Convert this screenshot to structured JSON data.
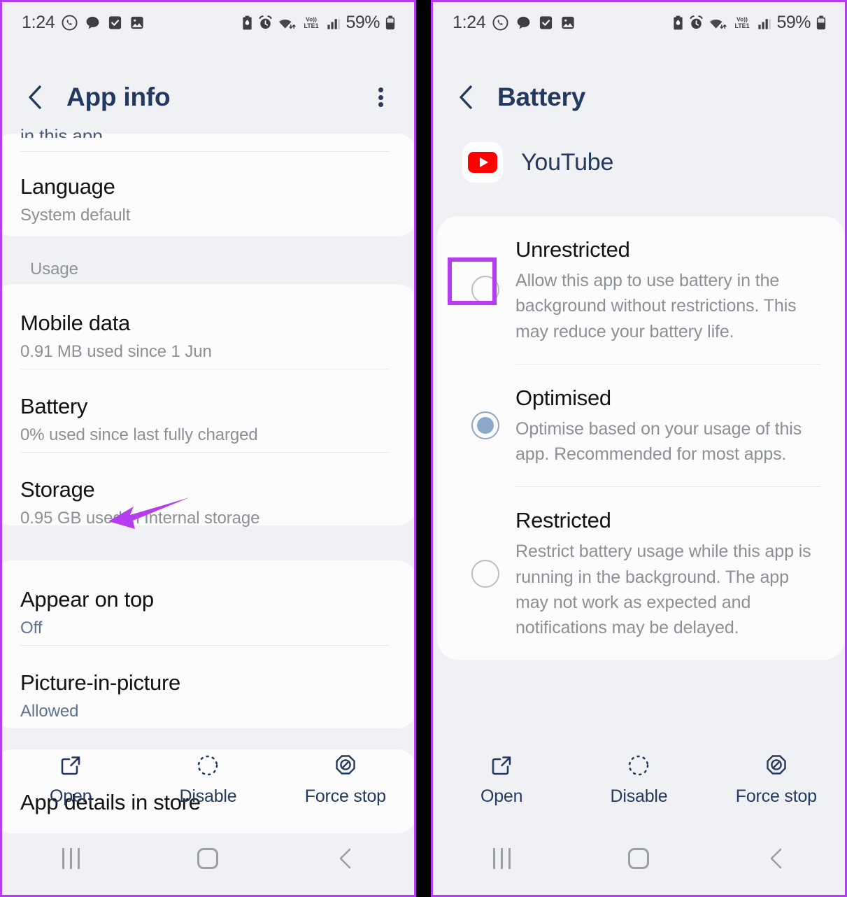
{
  "statusbar": {
    "time": "1:24",
    "battery_percent": "59%",
    "icons_left": [
      "whatsapp-icon",
      "chat-bubble-icon",
      "checkbox-icon",
      "gallery-image-icon"
    ],
    "icons_right": [
      "battery-saver-icon",
      "alarm-icon",
      "wifi-data-icon",
      "volte-lte1-icon",
      "signal-bars-icon",
      "battery-icon"
    ],
    "network_label": "Vo))",
    "network_sub": "LTE1"
  },
  "left_panel": {
    "header": {
      "title": "App info",
      "back_icon": "chevron-left-icon",
      "menu_icon": "more-vertical-icon"
    },
    "cut_off_top_text": "in this app",
    "language": {
      "title": "Language",
      "subtitle": "System default"
    },
    "section_usage": "Usage",
    "usage_rows": [
      {
        "title": "Mobile data",
        "subtitle": "0.91 MB used since 1 Jun"
      },
      {
        "title": "Battery",
        "subtitle": "0% used since last fully charged"
      },
      {
        "title": "Storage",
        "subtitle": "0.95 GB used in Internal storage"
      }
    ],
    "advanced_rows": [
      {
        "title": "Appear on top",
        "subtitle": "Off"
      },
      {
        "title": "Picture-in-picture",
        "subtitle": "Allowed"
      }
    ],
    "cut_off_bottom_text": "App details in store",
    "annotation": {
      "type": "arrow",
      "points_at": "Battery",
      "color": "#b43df0"
    }
  },
  "right_panel": {
    "header": {
      "title": "Battery",
      "back_icon": "chevron-left-icon"
    },
    "app": {
      "name": "YouTube",
      "icon": "youtube-icon"
    },
    "options": [
      {
        "title": "Unrestricted",
        "description": "Allow this app to use battery in the background without restrictions. This may reduce your battery life.",
        "selected": false,
        "highlighted": true
      },
      {
        "title": "Optimised",
        "description": "Optimise based on your usage of this app. Recommended for most apps.",
        "selected": true,
        "highlighted": false
      },
      {
        "title": "Restricted",
        "description": "Restrict battery usage while this app is running in the background. The app may not work as expected and notifications may be delayed.",
        "selected": false,
        "highlighted": false
      }
    ],
    "annotation": {
      "type": "box",
      "around": "Unrestricted radio button",
      "color": "#b43df0"
    }
  },
  "actionbar": {
    "items": [
      {
        "label": "Open",
        "icon": "open-external-icon"
      },
      {
        "label": "Disable",
        "icon": "disable-dashed-circle-icon"
      },
      {
        "label": "Force stop",
        "icon": "force-stop-icon"
      }
    ]
  },
  "navbar": {
    "items": [
      {
        "icon": "recents-icon"
      },
      {
        "icon": "home-icon"
      },
      {
        "icon": "back-icon"
      }
    ]
  },
  "colors": {
    "accent_annotation": "#b43df0",
    "header_text": "#23395e",
    "page_bg": "#eff1f5",
    "card_bg": "#fcfcfd",
    "youtube_red": "#ff0000",
    "radio_selected": "#8aa8c9"
  }
}
